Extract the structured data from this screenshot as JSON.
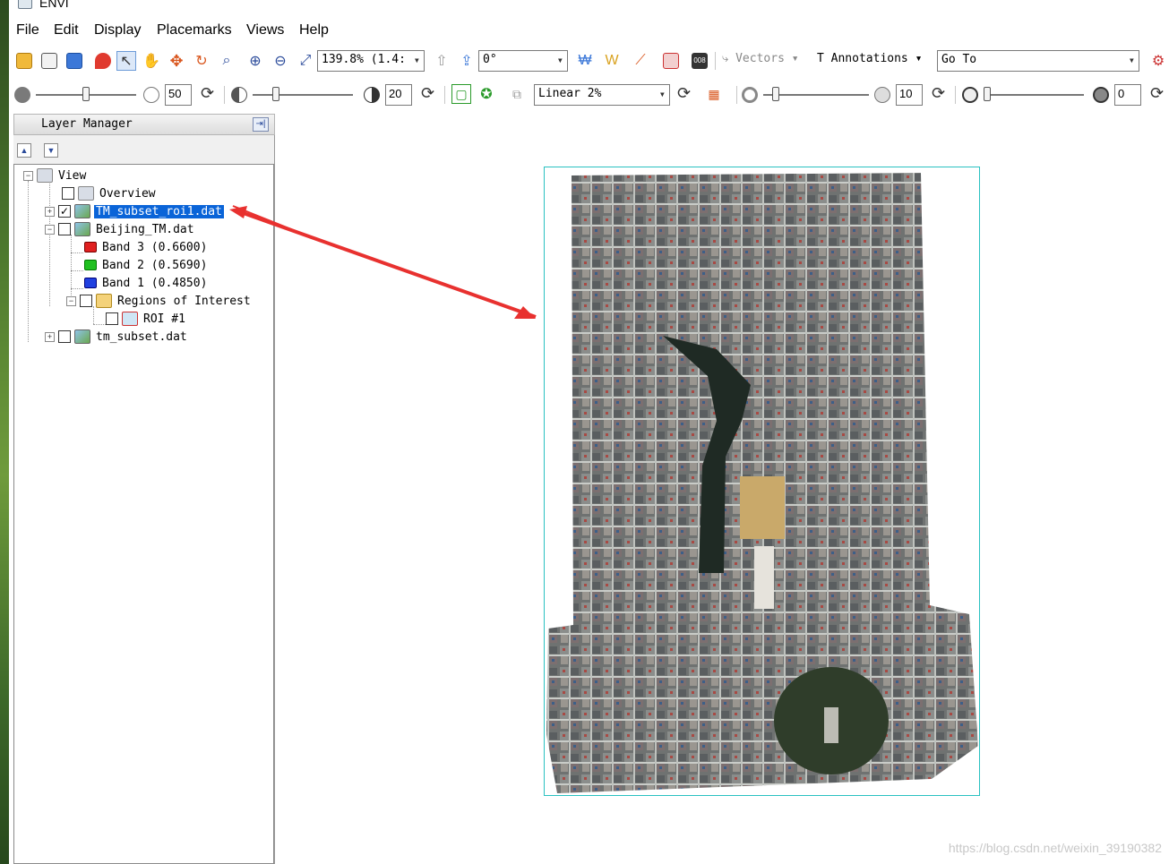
{
  "app": {
    "title": "ENVI"
  },
  "menu": [
    "File",
    "Edit",
    "Display",
    "Placemarks",
    "Views",
    "Help"
  ],
  "toolbar1": {
    "zoom_value": "139.8% (1.4:",
    "rotation_value": "0°",
    "vectors_label": "Vectors",
    "annotations_label": "Annotations",
    "goto_value": "Go To"
  },
  "toolbar2": {
    "brightness_value": "50",
    "contrast_value": "20",
    "stretch_value": "Linear 2%",
    "sharpen_value": "10",
    "transparency_value": "0"
  },
  "layer_manager": {
    "title": "Layer Manager",
    "tree": {
      "view": "View",
      "overview": "Overview",
      "subset_roi": "TM_subset_roi1.dat",
      "beijing": "Beijing_TM.dat",
      "band3": "Band 3 (0.6600)",
      "band2": "Band 2 (0.5690)",
      "band1": "Band 1 (0.4850)",
      "roi_folder": "Regions of Interest",
      "roi1": "ROI #1",
      "tm_subset": "tm_subset.dat"
    }
  },
  "watermark": "https://blog.csdn.net/weixin_39190382",
  "colors": {
    "selection": "#0a64d8",
    "arrow": "#e8312f",
    "frame": "#2ac1c1"
  }
}
